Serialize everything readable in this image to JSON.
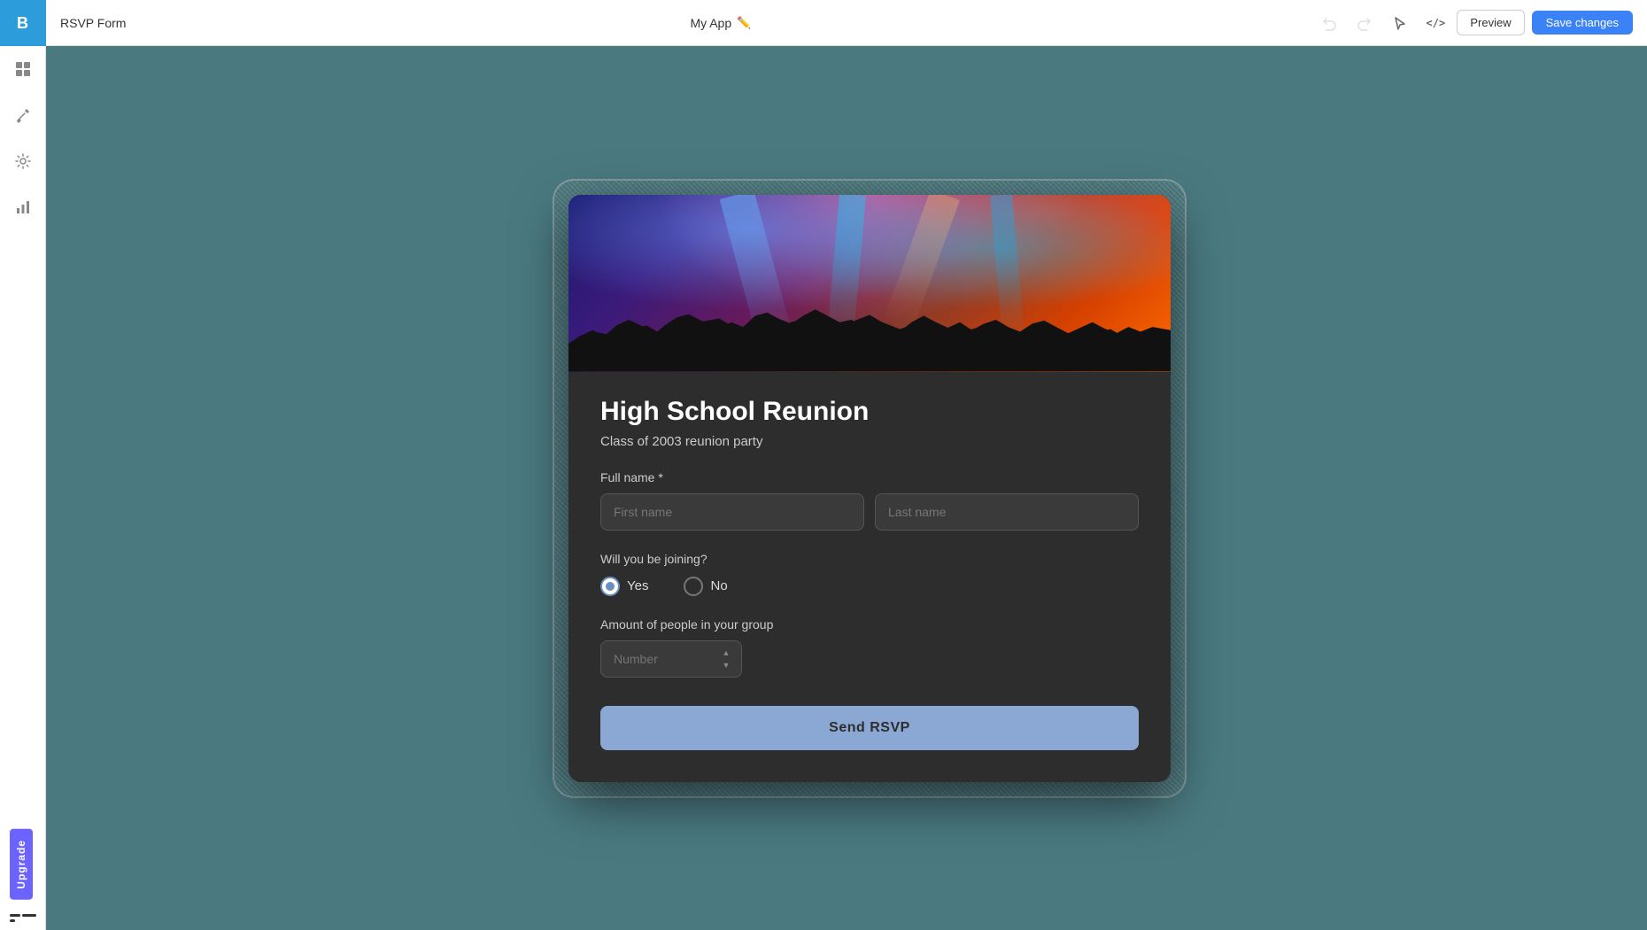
{
  "app": {
    "name": "RSVP Form",
    "logo": "B",
    "logo_color": "#2d9cdb"
  },
  "topbar": {
    "title": "RSVP Form",
    "center_label": "My App",
    "pencil_icon": "✏",
    "undo_icon": "↩",
    "redo_icon": "↪",
    "cursor_icon": "↖",
    "code_icon": "</>",
    "preview_label": "Preview",
    "save_label": "Save changes"
  },
  "sidebar": {
    "items": [
      {
        "icon": "▦",
        "name": "grid-icon",
        "label": "Grid"
      },
      {
        "icon": "⚒",
        "name": "tools-icon",
        "label": "Tools"
      },
      {
        "icon": "⚙",
        "name": "settings-icon",
        "label": "Settings"
      },
      {
        "icon": "📊",
        "name": "analytics-icon",
        "label": "Analytics"
      }
    ],
    "upgrade_label": "Upgrade"
  },
  "form": {
    "title": "High School Reunion",
    "subtitle": "Class of 2003 reunion party",
    "full_name_label": "Full name *",
    "first_name_placeholder": "First name",
    "last_name_placeholder": "Last name",
    "joining_label": "Will you be joining?",
    "yes_label": "Yes",
    "no_label": "No",
    "group_label": "Amount of people in your group",
    "number_placeholder": "Number",
    "send_label": "Send RSVP"
  }
}
